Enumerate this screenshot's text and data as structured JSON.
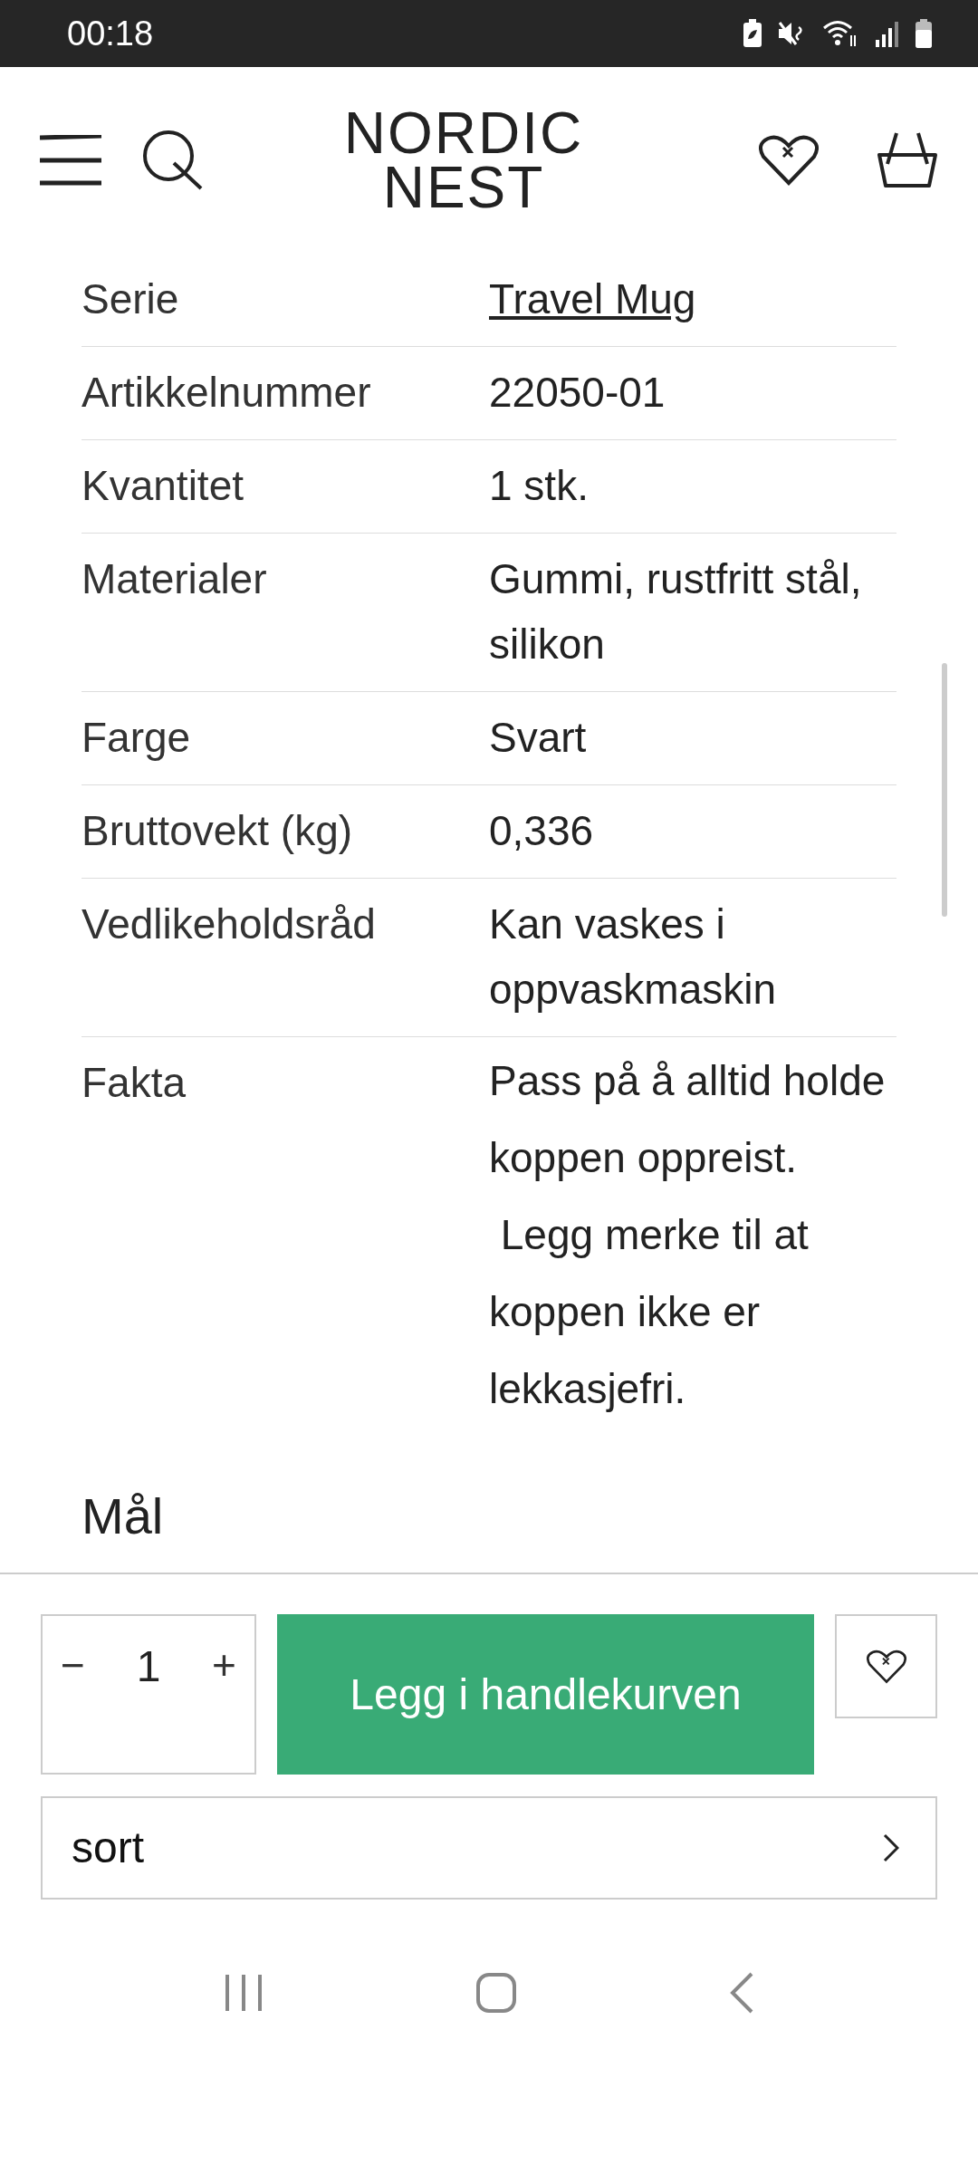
{
  "status_bar": {
    "time": "00:18"
  },
  "header": {
    "logo_line_1": "NORDIC",
    "logo_line_2": "NEST"
  },
  "specs": [
    {
      "label": "Serie",
      "value": "Travel Mug",
      "kind": "link"
    },
    {
      "label": "Artikkelnummer",
      "value": "22050-01",
      "kind": "text"
    },
    {
      "label": "Kvantitet",
      "value": "1 stk.",
      "kind": "text"
    },
    {
      "label": "Materialer",
      "value": "Gummi, rustfritt stål, silikon",
      "kind": "text"
    },
    {
      "label": "Farge",
      "value": "Svart",
      "kind": "text"
    },
    {
      "label": "Bruttovekt (kg)",
      "value": "0,336",
      "kind": "text"
    },
    {
      "label": "Vedlikeholdsråd",
      "value": "Kan vaskes i oppvaskmaskin",
      "kind": "text"
    },
    {
      "label": "Fakta",
      "value": "Pass på å alltid holde koppen oppreist.\n Legg merke til at koppen ikke er lekkasjefri.",
      "kind": "note"
    }
  ],
  "section_heading": "Mål",
  "purchase": {
    "quantity": "1",
    "minus": "−",
    "plus": "+",
    "add_button": "Legg i handlekurven",
    "variant": "sort"
  }
}
